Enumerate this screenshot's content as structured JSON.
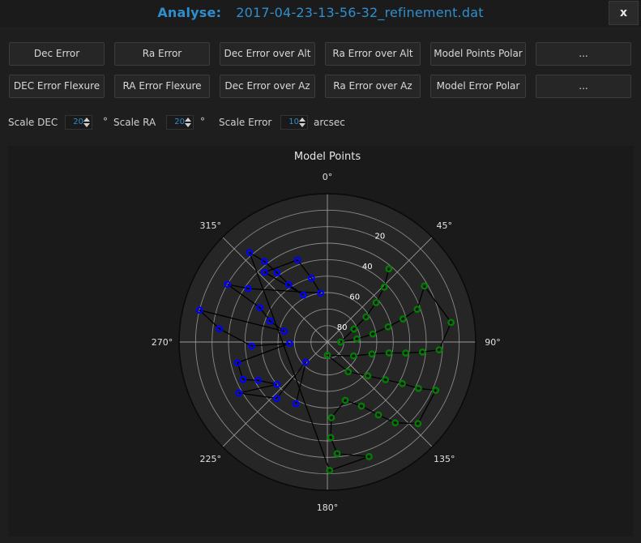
{
  "window": {
    "title_label": "Analyse:",
    "title_file": "2017-04-23-13-56-32_refinement.dat",
    "close_label": "x"
  },
  "buttons": {
    "row1": [
      "Dec Error",
      "Ra Error",
      "Dec Error over Alt",
      "Ra Error over Alt",
      "Model Points Polar",
      "..."
    ],
    "row2": [
      "DEC Error Flexure",
      "RA Error Flexure",
      "Dec Error over Az",
      "Ra Error over Az",
      "Model Error Polar",
      "..."
    ]
  },
  "scales": {
    "dec_label": "Scale DEC",
    "dec_value": "20",
    "dec_unit": "°",
    "ra_label": "Scale RA",
    "ra_value": "20",
    "ra_unit": "°",
    "err_label": "Scale Error",
    "err_value": "10",
    "err_unit": "arcsec"
  },
  "colors": {
    "accent": "#2f8fce",
    "west_points": "#0000ff",
    "east_points": "#008000",
    "path_line": "#000000",
    "plot_bg": "#1a1a1a"
  },
  "chart_data": {
    "type": "scatter",
    "projection": "polar",
    "title": "Model Points",
    "theta_zero": "N",
    "theta_direction": "clockwise",
    "theta_ticks": [
      "0°",
      "45°",
      "90°",
      "135°",
      "180°",
      "225°",
      "270°",
      "315°"
    ],
    "r_ticks": [
      "20",
      "40",
      "60",
      "80"
    ],
    "r_axis": "altitude (90 at center, 0 at edge)",
    "points": [
      {
        "az": 40,
        "alt": 32,
        "side": "E"
      },
      {
        "az": 46,
        "alt": 42,
        "side": "E"
      },
      {
        "az": 51,
        "alt": 52,
        "side": "E"
      },
      {
        "az": 57,
        "alt": 62,
        "side": "E"
      },
      {
        "az": 64,
        "alt": 72,
        "side": "E"
      },
      {
        "az": 90,
        "alt": 82,
        "side": "E"
      },
      {
        "az": 84,
        "alt": 72,
        "side": "E"
      },
      {
        "az": 80,
        "alt": 62,
        "side": "E"
      },
      {
        "az": 76,
        "alt": 52,
        "side": "E"
      },
      {
        "az": 73,
        "alt": 42,
        "side": "E"
      },
      {
        "az": 70,
        "alt": 32,
        "side": "E"
      },
      {
        "az": 60,
        "alt": 22,
        "side": "E"
      },
      {
        "az": 81,
        "alt": 14,
        "side": "E"
      },
      {
        "az": 94,
        "alt": 22,
        "side": "E"
      },
      {
        "az": 96,
        "alt": 32,
        "side": "E"
      },
      {
        "az": 98,
        "alt": 42,
        "side": "E"
      },
      {
        "az": 100,
        "alt": 52,
        "side": "E"
      },
      {
        "az": 105,
        "alt": 62,
        "side": "E"
      },
      {
        "az": 118,
        "alt": 72,
        "side": "E"
      },
      {
        "az": 180,
        "alt": 82,
        "side": "E"
      },
      {
        "az": 145,
        "alt": 68,
        "side": "E"
      },
      {
        "az": 130,
        "alt": 58,
        "side": "E"
      },
      {
        "az": 123,
        "alt": 48,
        "side": "E"
      },
      {
        "az": 119,
        "alt": 38,
        "side": "E"
      },
      {
        "az": 117,
        "alt": 28,
        "side": "E"
      },
      {
        "az": 114,
        "alt": 18,
        "side": "E"
      },
      {
        "az": 132,
        "alt": 16,
        "side": "E"
      },
      {
        "az": 140,
        "alt": 26,
        "side": "E"
      },
      {
        "az": 145,
        "alt": 36,
        "side": "E"
      },
      {
        "az": 152,
        "alt": 46,
        "side": "E"
      },
      {
        "az": 163,
        "alt": 53,
        "side": "E"
      },
      {
        "az": 177,
        "alt": 44,
        "side": "E"
      },
      {
        "az": 178,
        "alt": 32,
        "side": "E"
      },
      {
        "az": 175,
        "alt": 22,
        "side": "E"
      },
      {
        "az": 160,
        "alt": 16,
        "side": "E"
      },
      {
        "az": 179,
        "alt": 12,
        "side": "E"
      },
      {
        "az": 319,
        "alt": 18,
        "side": "W"
      },
      {
        "az": 322,
        "alt": 28,
        "side": "W"
      },
      {
        "az": 324,
        "alt": 38,
        "side": "W"
      },
      {
        "az": 326,
        "alt": 48,
        "side": "W"
      },
      {
        "az": 333,
        "alt": 58,
        "side": "W"
      },
      {
        "az": 318,
        "alt": 33,
        "side": "W"
      },
      {
        "az": 340,
        "alt": 37,
        "side": "W"
      },
      {
        "az": 346,
        "alt": 50,
        "side": "W"
      },
      {
        "az": 352,
        "alt": 60,
        "side": "W"
      },
      {
        "az": 304,
        "alt": 32,
        "side": "W"
      },
      {
        "az": 300,
        "alt": 20,
        "side": "W"
      },
      {
        "az": 297,
        "alt": 44,
        "side": "W"
      },
      {
        "az": 290,
        "alt": 53,
        "side": "W"
      },
      {
        "az": 284,
        "alt": 63,
        "side": "W"
      },
      {
        "az": 284,
        "alt": 10,
        "side": "W"
      },
      {
        "az": 277,
        "alt": 24,
        "side": "W"
      },
      {
        "az": 267,
        "alt": 44,
        "side": "W"
      },
      {
        "az": 268,
        "alt": 67,
        "side": "W"
      },
      {
        "az": 257,
        "alt": 34,
        "side": "W"
      },
      {
        "az": 246,
        "alt": 34,
        "side": "W"
      },
      {
        "az": 241,
        "alt": 42,
        "side": "W"
      },
      {
        "az": 230,
        "alt": 50,
        "side": "W"
      },
      {
        "az": 240,
        "alt": 28,
        "side": "W"
      },
      {
        "az": 222,
        "alt": 44,
        "side": "W"
      },
      {
        "az": 227,
        "alt": 72,
        "side": "W"
      },
      {
        "az": 207,
        "alt": 48,
        "side": "W"
      }
    ]
  }
}
